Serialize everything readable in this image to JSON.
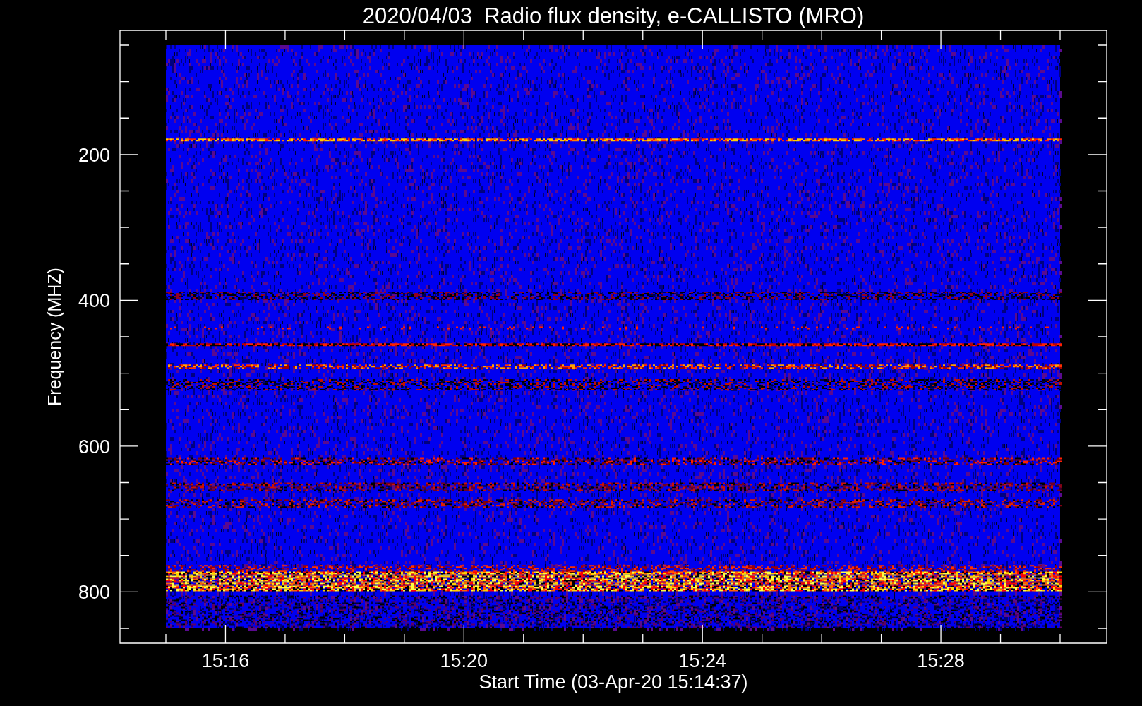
{
  "title": "2020/04/03  Radio flux density, e-CALLISTO (MRO)",
  "y_axis": {
    "label": "Frequency (MHZ)",
    "tick_labels": [
      "200",
      "400",
      "600",
      "800"
    ]
  },
  "x_axis": {
    "label": "Start Time (03-Apr-20 15:14:37)",
    "tick_labels": [
      "15:16",
      "15:20",
      "15:24",
      "15:28"
    ]
  }
}
